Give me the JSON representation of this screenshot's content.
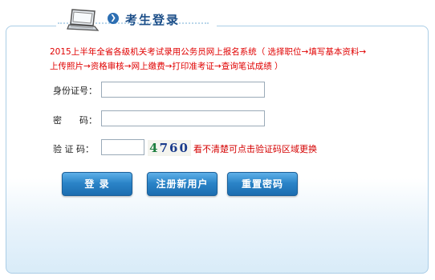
{
  "header": {
    "title": "考生登录",
    "icon": "laptop-icon",
    "arrow_icon": "circle-chevron-right-icon"
  },
  "notice": {
    "line1": "2015上半年全省各级机关考试录用公务员网上报名系统（ 选择职位→填写基本资料→",
    "line2": "上传照片→资格审核→网上缴费→打印准考证→查询笔试成绩 ）"
  },
  "form": {
    "id_label": "身份证号：",
    "id_value": "",
    "password_label": "密　　码：",
    "password_value": "",
    "captcha_label": "验 证 码：",
    "captcha_value": "",
    "captcha_digits": [
      "4",
      "7",
      "6",
      "0"
    ],
    "captcha_hint": "看不清楚可点击验证码区域更换"
  },
  "buttons": {
    "login": "登 录",
    "register": "注册新用户",
    "reset_password": "重置密码"
  },
  "colors": {
    "title": "#1d4f89",
    "notice": "#e00000",
    "button": "#2b84c8",
    "panel_border": "#aacde6"
  }
}
